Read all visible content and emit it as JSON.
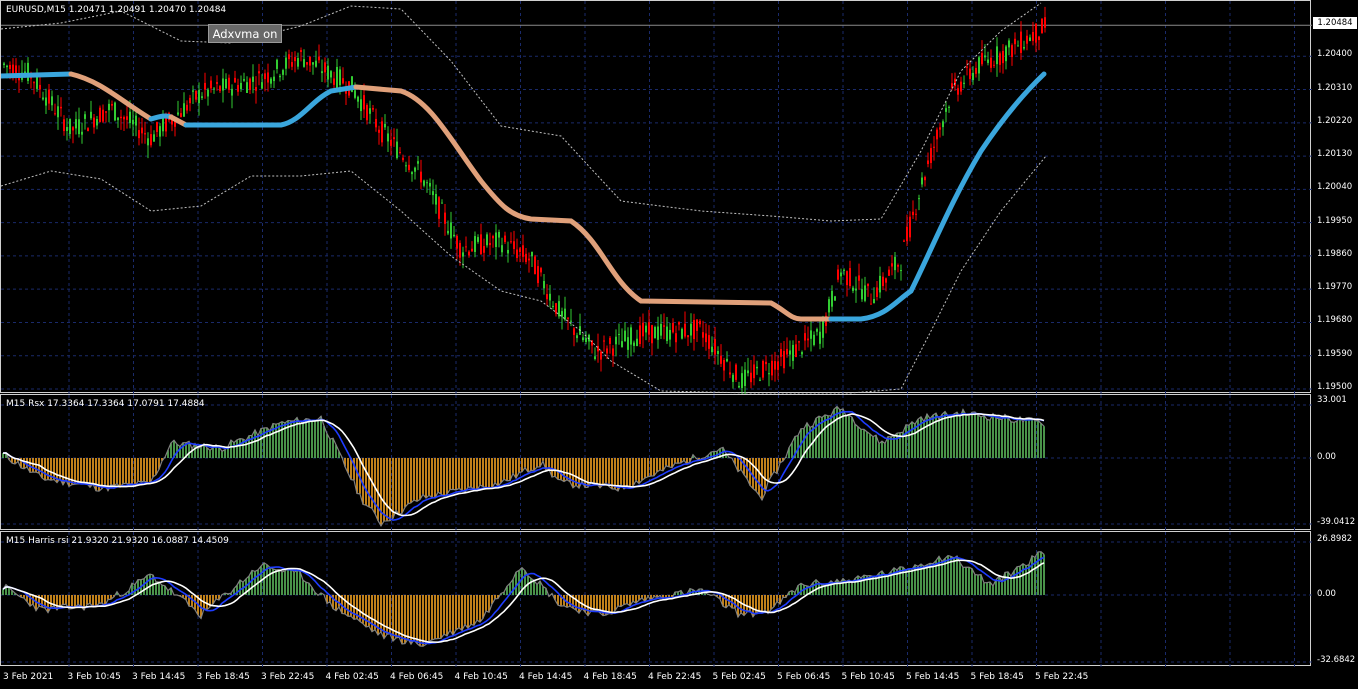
{
  "main_chart": {
    "header": "EURUSD,M15  1.20471 1.20491 1.20470 1.20484",
    "button_label": "Adxvma on",
    "current_price": "1.20484",
    "price_ticks": [
      "1.20400",
      "1.20310",
      "1.20220",
      "1.20130",
      "1.20040",
      "1.19950",
      "1.19860",
      "1.19770",
      "1.19680",
      "1.19590",
      "1.19500"
    ]
  },
  "rsx_panel": {
    "header": "M15 Rsx 17.3364 17.3364 17.0791 17.4884",
    "ticks": [
      "33.001",
      "0.00",
      "-39.0412"
    ]
  },
  "harris_panel": {
    "header": "M15 Harris rsi 21.9320 21.9320 16.0887 14.4509",
    "ticks": [
      "26.8982",
      "0.00",
      "-32.6842"
    ]
  },
  "time_axis": [
    "3 Feb 2021",
    "3 Feb 10:45",
    "3 Feb 14:45",
    "3 Feb 18:45",
    "3 Feb 22:45",
    "4 Feb 02:45",
    "4 Feb 06:45",
    "4 Feb 10:45",
    "4 Feb 14:45",
    "4 Feb 18:45",
    "4 Feb 22:45",
    "5 Feb 02:45",
    "5 Feb 06:45",
    "5 Feb 10:45",
    "5 Feb 14:45",
    "5 Feb 18:45",
    "5 Feb 22:45"
  ],
  "colors": {
    "bull_candle": "#32cd32",
    "bear_candle": "#ff0000",
    "adxvma_up": "#3aa6dd",
    "adxvma_flat": "#e0a07a",
    "band": "#c0c0c0",
    "hist_pos": "#5cb85c",
    "hist_neg": "#f0a020",
    "signal_blue": "#1e3cff",
    "signal_white": "#ffffff",
    "grid": "#1a2a6a"
  },
  "chart_data": {
    "type": "line",
    "title": "EURUSD,M15",
    "ylim": [
      1.195,
      1.2049
    ],
    "x": [
      "3 Feb 2021",
      "3 Feb 10:45",
      "3 Feb 14:45",
      "3 Feb 18:45",
      "3 Feb 22:45",
      "4 Feb 02:45",
      "4 Feb 06:45",
      "4 Feb 10:45",
      "4 Feb 14:45",
      "4 Feb 18:45",
      "4 Feb 22:45",
      "5 Feb 02:45",
      "5 Feb 06:45",
      "5 Feb 10:45",
      "5 Feb 14:45",
      "5 Feb 18:45",
      "5 Feb 22:45"
    ],
    "series": [
      {
        "values": [
          1.2038,
          1.2025,
          1.2028,
          1.203,
          1.2036,
          1.203,
          1.2012,
          1.1993,
          1.1985,
          1.1962,
          1.1965,
          1.1955,
          1.1965,
          1.1975,
          1.201,
          1.204,
          1.2048
        ]
      },
      {
        "values": [
          1.2035,
          1.2035,
          1.2022,
          1.2022,
          1.2022,
          1.2032,
          1.2025,
          1.1996,
          1.1994,
          1.1973,
          1.1973,
          1.1972,
          1.1969,
          1.1971,
          1.199,
          1.202,
          1.2036
        ]
      }
    ]
  }
}
